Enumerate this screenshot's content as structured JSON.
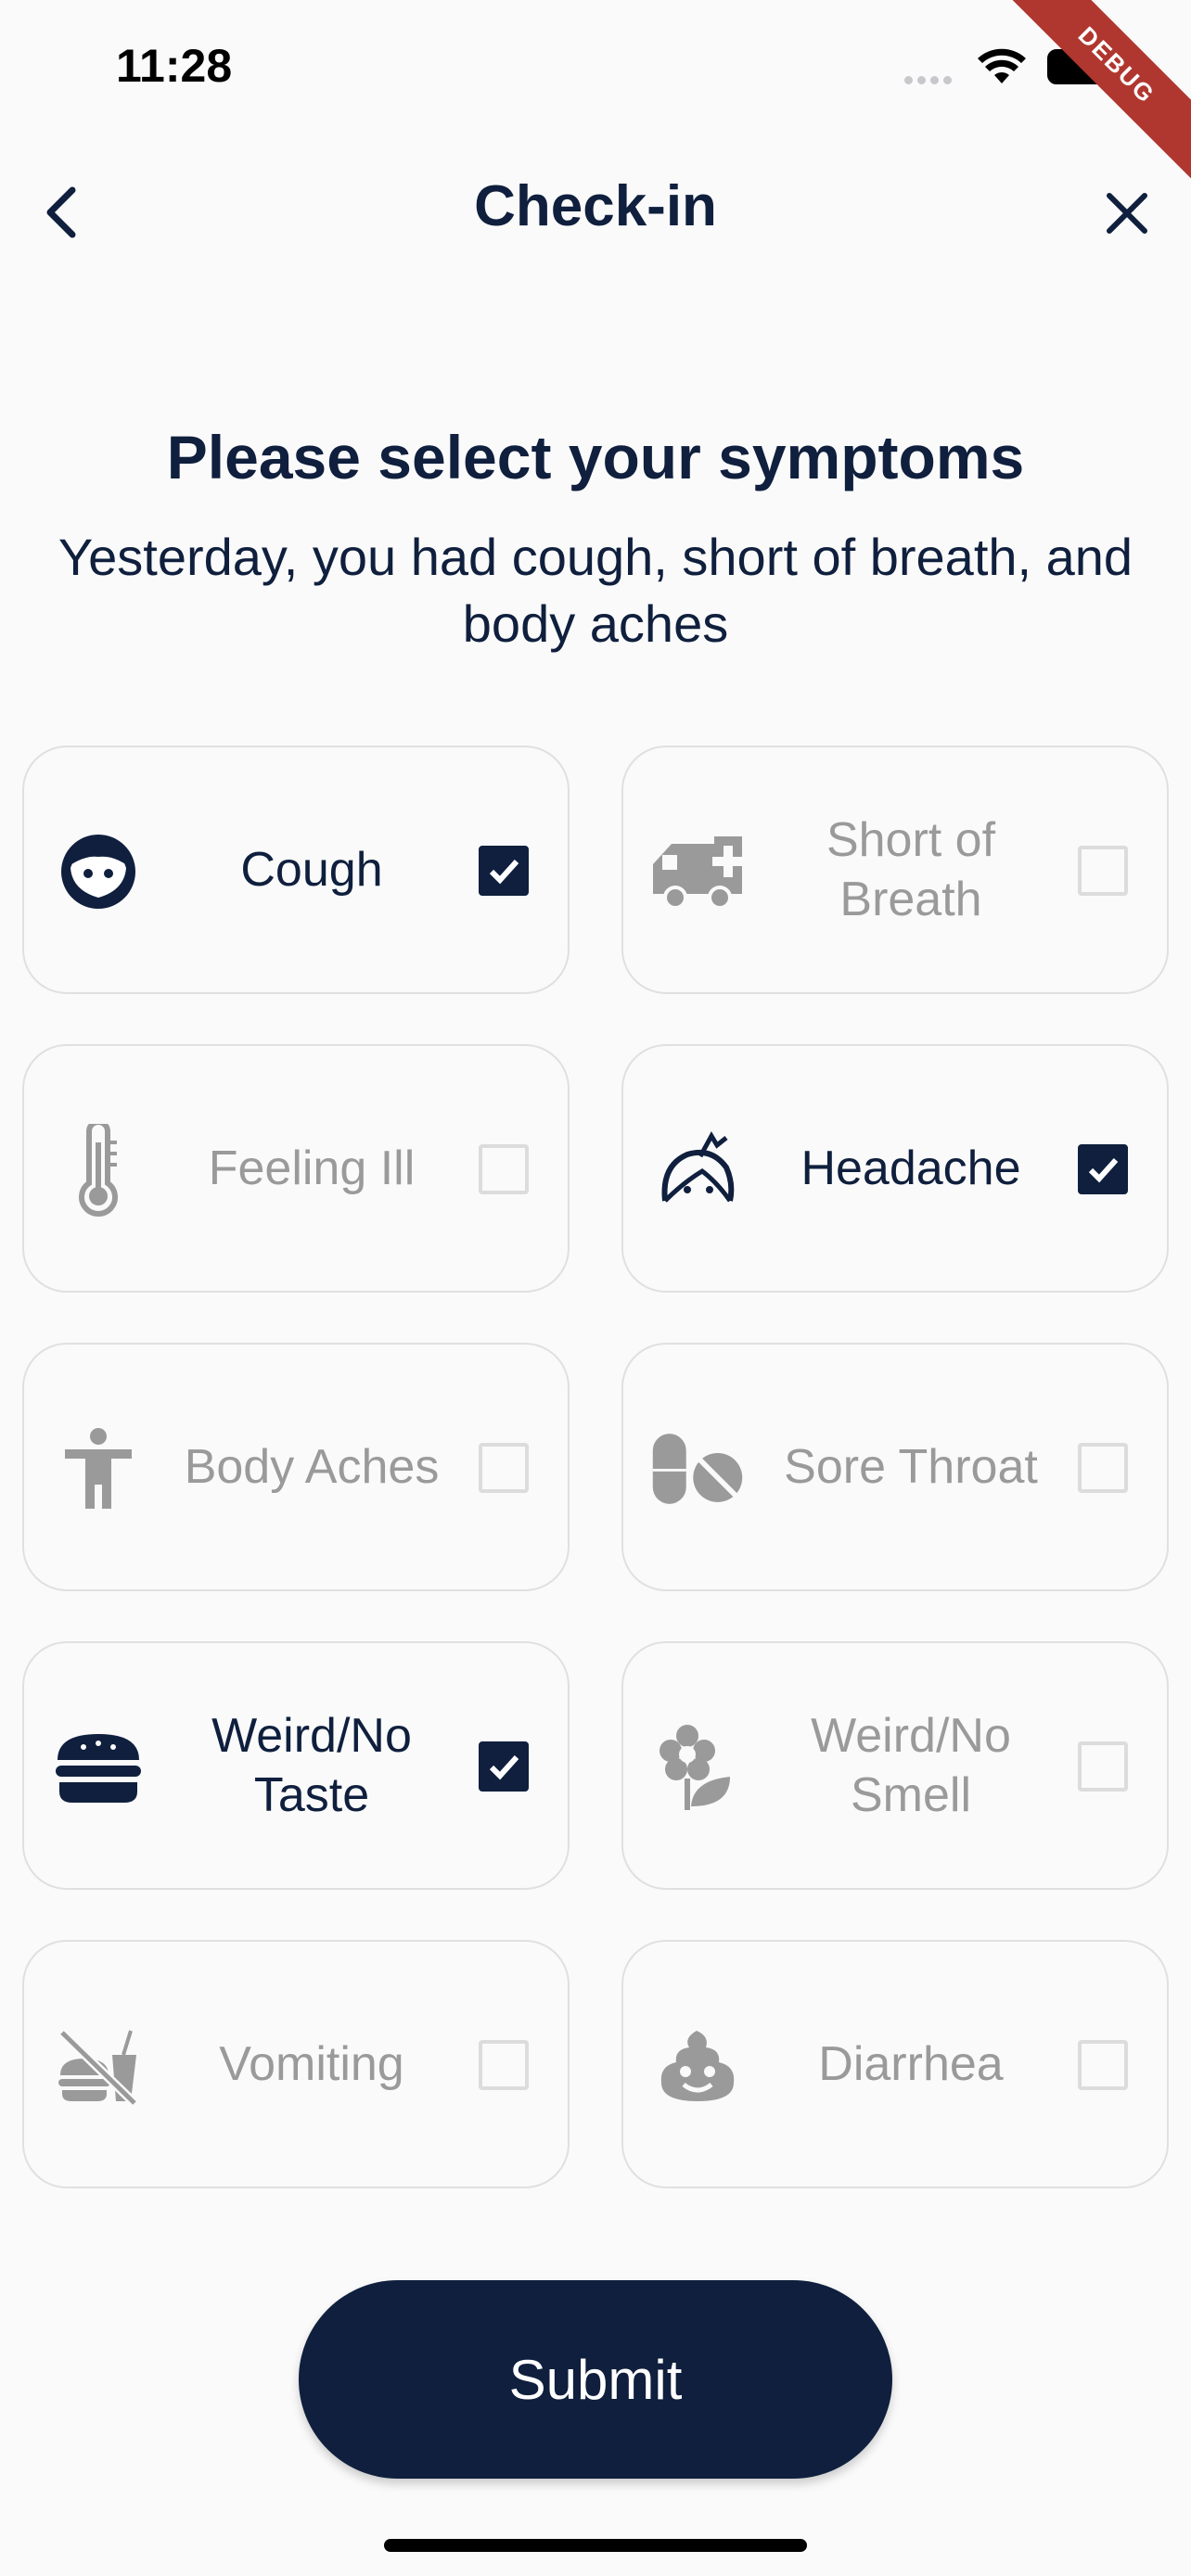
{
  "status_bar": {
    "time": "11:28",
    "debug_label": "DEBUG"
  },
  "header": {
    "title": "Check-in",
    "back_icon": "chevron-left-icon",
    "close_icon": "close-icon"
  },
  "heading": "Please select your symptoms",
  "subtitle": "Yesterday, you had cough, short of breath, and body aches",
  "symptoms": [
    {
      "label": "Cough",
      "icon": "face-icon",
      "checked": true
    },
    {
      "label": "Short of Breath",
      "icon": "ambulance-icon",
      "checked": false
    },
    {
      "label": "Feeling Ill",
      "icon": "thermometer-icon",
      "checked": false
    },
    {
      "label": "Headache",
      "icon": "headache-icon",
      "checked": true
    },
    {
      "label": "Body Aches",
      "icon": "person-icon",
      "checked": false
    },
    {
      "label": "Sore Throat",
      "icon": "pills-icon",
      "checked": false
    },
    {
      "label": "Weird/No Taste",
      "icon": "burger-icon",
      "checked": true
    },
    {
      "label": "Weird/No Smell",
      "icon": "flower-icon",
      "checked": false
    },
    {
      "label": "Vomiting",
      "icon": "no-food-icon",
      "checked": false
    },
    {
      "label": "Diarrhea",
      "icon": "poop-icon",
      "checked": false
    }
  ],
  "submit_label": "Submit",
  "colors": {
    "primary": "#0f1f3d",
    "inactive": "#9a9a9a",
    "border": "#e0e0e0",
    "debug": "#b0372f"
  }
}
